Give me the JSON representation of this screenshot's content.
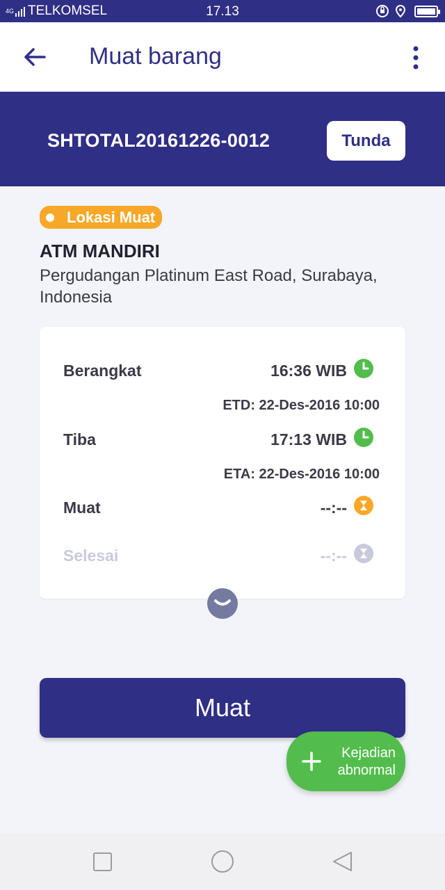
{
  "status_bar": {
    "network_type": "4G",
    "carrier": "TELKOMSEL",
    "time": "17.13",
    "icons": [
      "data-saver-icon",
      "location-icon",
      "battery-icon"
    ]
  },
  "app_bar": {
    "title": "Muat barang",
    "back_icon": "arrow-left-icon",
    "menu_icon": "more-vertical-icon"
  },
  "shipment": {
    "id": "SHTOTAL20161226-0012",
    "hold_button_label": "Tunda"
  },
  "location": {
    "badge_label": "Lokasi Muat",
    "name": "ATM MANDIRI",
    "address": "Pergudangan Platinum East Road, Surabaya, Indonesia"
  },
  "timeline": [
    {
      "label": "Berangkat",
      "value": "16:36 WIB",
      "estimate": "ETD: 22-Des-2016 10:00",
      "status_icon": "clock-icon",
      "status": "done"
    },
    {
      "label": "Tiba",
      "value": "17:13 WIB",
      "estimate": "ETA: 22-Des-2016 10:00",
      "status_icon": "clock-icon",
      "status": "done"
    },
    {
      "label": "Muat",
      "value": "--:--",
      "estimate": "",
      "status_icon": "hourglass-icon",
      "status": "pending"
    },
    {
      "label": "Selesai",
      "value": "--:--",
      "estimate": "",
      "status_icon": "hourglass-icon",
      "status": "disabled"
    }
  ],
  "expand_icon": "chevron-down-icon",
  "primary_action_label": "Muat",
  "fab": {
    "icon": "plus-icon",
    "label_line1": "Kejadian",
    "label_line2": "abnormal"
  },
  "nav_bar": {
    "icons": [
      "recent-apps-icon",
      "home-icon",
      "back-triangle-icon"
    ]
  },
  "colors": {
    "primary": "#2f2f86",
    "badge": "#f7a828",
    "done": "#52bd4c",
    "pending": "#f7a828",
    "disabled": "#c8cadc",
    "background": "#f3f4fa"
  }
}
